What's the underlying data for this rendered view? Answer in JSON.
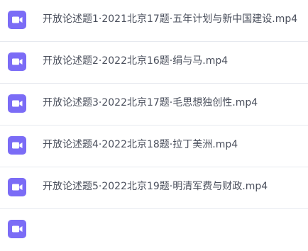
{
  "files": [
    {
      "name": "开放论述题1·2021北京17题·五年计划与新中国建设.mp4",
      "icon": "video-file-icon"
    },
    {
      "name": "开放论述题2·2022北京16题·绢与马.mp4",
      "icon": "video-file-icon"
    },
    {
      "name": "开放论述题3·2022北京17题·毛思想独创性.mp4",
      "icon": "video-file-icon"
    },
    {
      "name": "开放论述题4·2022北京18题·拉丁美洲.mp4",
      "icon": "video-file-icon"
    },
    {
      "name": "开放论述题5·2022北京19题·明清军费与财政.mp4",
      "icon": "video-file-icon"
    }
  ],
  "colors": {
    "icon_bg": "#7b6cf6",
    "text": "#4a4f5c",
    "divider": "#e6e9ef"
  }
}
